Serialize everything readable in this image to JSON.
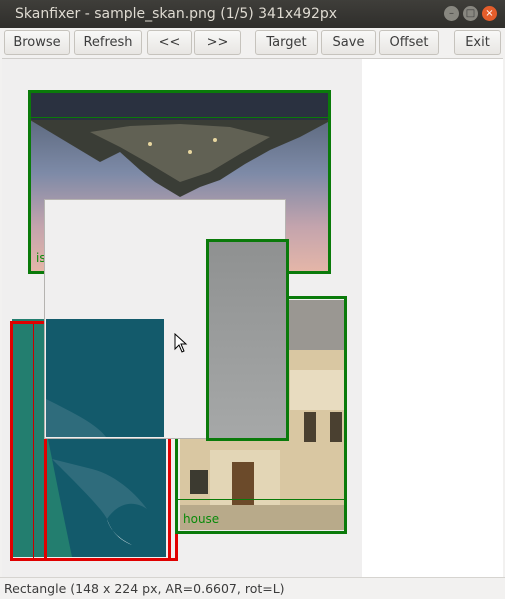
{
  "window": {
    "title": "Skanfixer - sample_skan.png (1/5) 341x492px",
    "controls": {
      "minimize": "–",
      "maximize": "□",
      "close": "×"
    }
  },
  "toolbar": {
    "browse": "Browse",
    "refresh": "Refresh",
    "prev": "<<",
    "next": ">>",
    "target": "Target",
    "save": "Save",
    "offset": "Offset",
    "exit": "Exit"
  },
  "canvas": {
    "labels": {
      "island": "is",
      "house": "house"
    }
  },
  "status": {
    "text": "Rectangle (148 x 224 px, AR=0.6607, rot=L)"
  },
  "colors": {
    "selection_green": "#0a7a0a",
    "active_red": "#e00000",
    "close_orange": "#e45d2b"
  }
}
